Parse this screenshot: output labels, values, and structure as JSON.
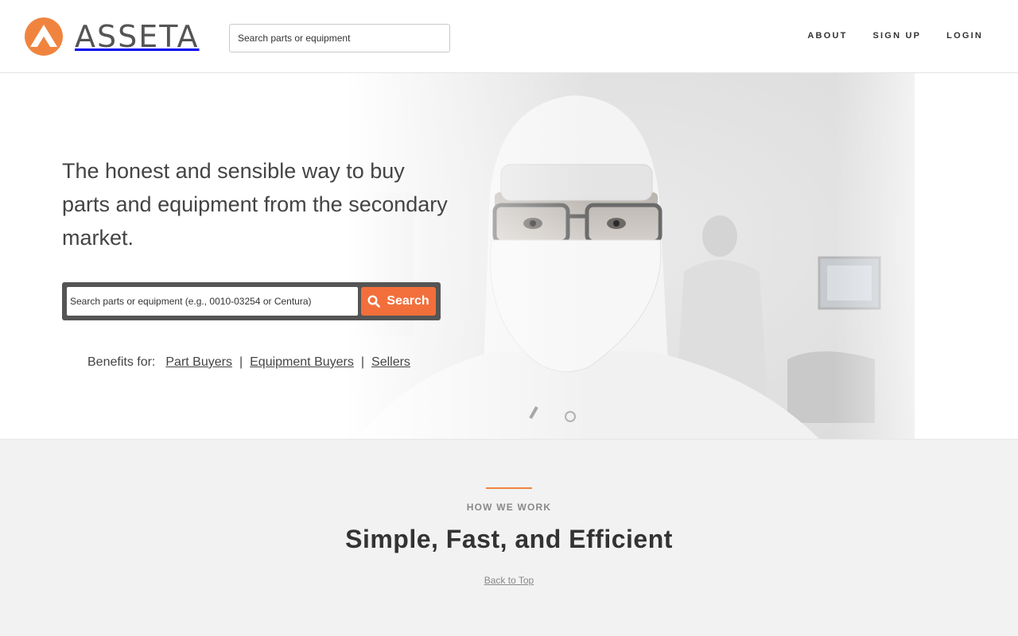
{
  "brand": {
    "name": "ASSETA",
    "accent_color": "#f0843f",
    "logo_icon": "asseta-logo-icon"
  },
  "header": {
    "search_placeholder": "Search parts or equipment",
    "nav": [
      {
        "label": "ABOUT"
      },
      {
        "label": "SIGN UP"
      },
      {
        "label": "LOGIN"
      }
    ]
  },
  "hero": {
    "headline": "The honest and sensible way to buy parts and equipment from the secondary market.",
    "search_placeholder": "Search parts or equipment (e.g., 0010-03254 or Centura)",
    "search_button": "Search",
    "search_button_color": "#f26f3b",
    "search_icon": "search-icon",
    "benefits_label": "Benefits for:",
    "benefits_links": [
      "Part Buyers",
      "Equipment Buyers",
      "Sellers"
    ],
    "benefits_separator": "|",
    "photo": "cleanroom-technician-photo"
  },
  "how_we_work": {
    "kicker": "HOW WE WORK",
    "title": "Simple, Fast, and Efficient",
    "back_to_top": "Back to Top"
  }
}
